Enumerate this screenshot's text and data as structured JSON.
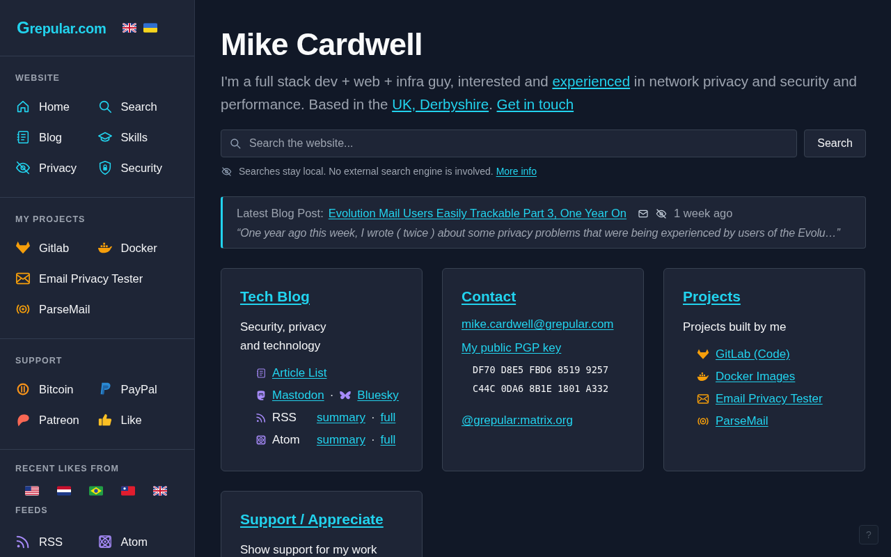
{
  "sidebar": {
    "logo": "Grepular.com",
    "sections": [
      {
        "heading": "WEBSITE",
        "rows": [
          [
            "Home",
            "Search"
          ],
          [
            "Blog",
            "Skills"
          ],
          [
            "Privacy",
            "Security"
          ]
        ]
      },
      {
        "heading": "MY PROJECTS",
        "rows": [
          [
            "Gitlab",
            "Docker"
          ],
          [
            "Email Privacy Tester"
          ],
          [
            "ParseMail"
          ]
        ]
      },
      {
        "heading": "SUPPORT",
        "rows": [
          [
            "Bitcoin",
            "PayPal"
          ],
          [
            "Patreon",
            "Like"
          ]
        ]
      }
    ],
    "recent_likes": {
      "heading": "RECENT LIKES FROM"
    },
    "feeds": {
      "heading": "FEEDS",
      "rows": [
        [
          "RSS",
          "Atom"
        ]
      ]
    }
  },
  "main": {
    "title": "Mike Cardwell",
    "intro": [
      {
        "kind": "text",
        "text": "I'm a full stack dev + web + infra guy, interested and "
      },
      {
        "kind": "link",
        "text": "experienced"
      },
      {
        "kind": "text",
        "text": " in network privacy and security and performance. Based in the "
      },
      {
        "kind": "link",
        "text": "UK, Derbyshire"
      },
      {
        "kind": "text",
        "text": ". "
      },
      {
        "kind": "link",
        "text": "Get in touch"
      }
    ],
    "search": {
      "placeholder": "Search the website...",
      "button": "Search",
      "note": "Searches stay local. No external search engine is involved.",
      "note_link": "More info"
    },
    "latest_post": {
      "label": "Latest Blog Post:",
      "title": "Evolution Mail Users Easily Trackable Part 3, One Year On",
      "age": "1 week ago",
      "excerpt": "“One year ago this week, I wrote ( twice ) about some privacy problems that were being experienced by users of the Evolu…”"
    },
    "cards": [
      {
        "kind": "blog",
        "heading": "Tech Blog",
        "description": "Security, privacy and technology",
        "rows": [
          {
            "parts": [
              {
                "kind": "link",
                "text": "Article List"
              }
            ]
          },
          {
            "parts": [
              {
                "kind": "link",
                "text": "Mastodon"
              },
              {
                "kind": "sep",
                "text": "·"
              },
              {
                "kind": "link",
                "text": "Bluesky"
              }
            ]
          },
          {
            "label": "RSS",
            "parts": [
              {
                "kind": "link",
                "text": "summary"
              },
              {
                "kind": "sep",
                "text": "·"
              },
              {
                "kind": "link",
                "text": "full"
              }
            ]
          },
          {
            "label": "Atom",
            "parts": [
              {
                "kind": "link",
                "text": "summary"
              },
              {
                "kind": "sep",
                "text": "·"
              },
              {
                "kind": "link",
                "text": "full"
              }
            ]
          }
        ]
      },
      {
        "kind": "contact",
        "heading": "Contact",
        "email": "mike.cardwell@grepular.com",
        "pgp_link": "My public PGP key",
        "fingerprint": [
          "DF70 D8E5 FBD6 8519 9257",
          "C44C 0DA6 8B1E 1801 A332"
        ],
        "matrix": "@grepular:matrix.org"
      },
      {
        "kind": "projects",
        "heading": "Projects",
        "description": "Projects built by me",
        "links": [
          "GitLab (Code)",
          "Docker Images",
          "Email Privacy Tester",
          "ParseMail"
        ]
      },
      {
        "kind": "support",
        "heading": "Support / Appreciate",
        "description": "Show support for my work"
      }
    ]
  },
  "help_button": "?"
}
